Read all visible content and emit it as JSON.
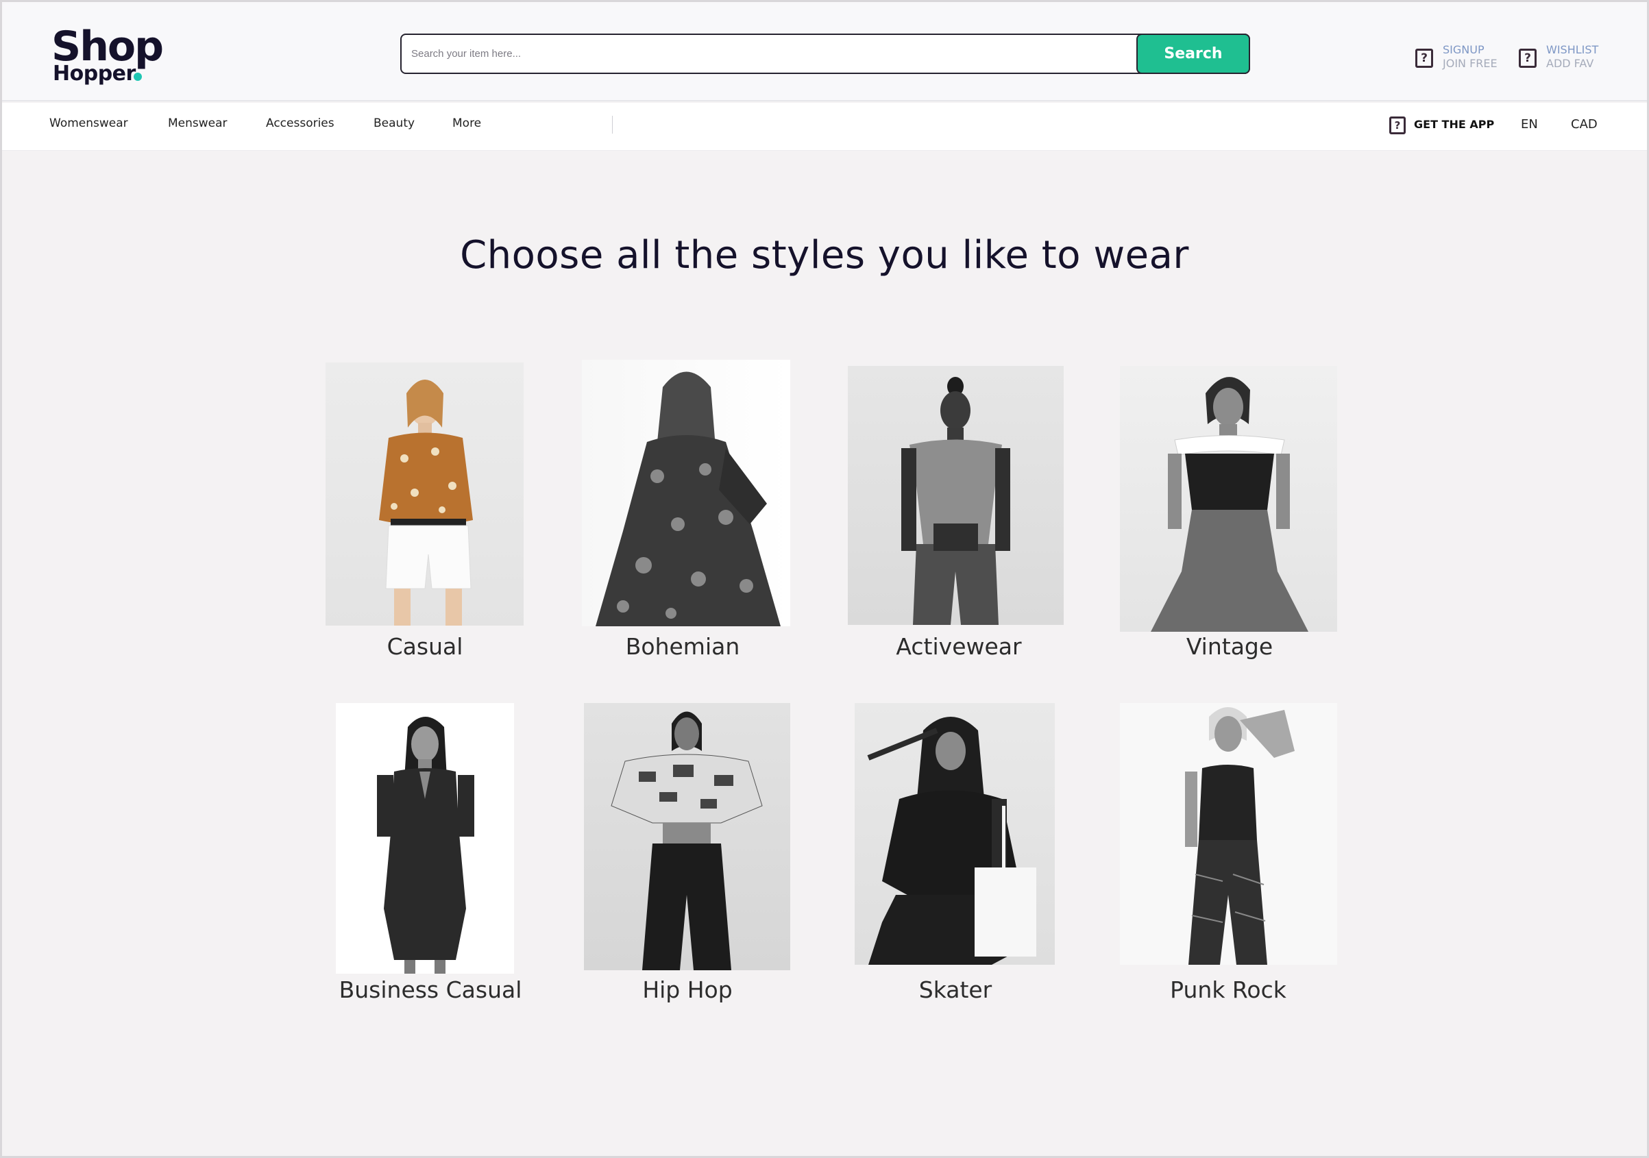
{
  "header": {
    "logo": {
      "word1": "Shop",
      "word2": "Hopper"
    },
    "search": {
      "placeholder": "Search your item here...",
      "button_label": "Search"
    },
    "signup": {
      "line1": "SIGNUP",
      "line2": "JOIN FREE",
      "icon": "question-box-icon"
    },
    "wishlist": {
      "line1": "WISHLIST",
      "line2": "ADD FAV",
      "icon": "question-box-icon"
    }
  },
  "nav": {
    "items": [
      "Womenswear",
      "Menswear",
      "Accessories",
      "Beauty",
      "More"
    ],
    "get_app": "GET THE APP",
    "language": "EN",
    "currency": "CAD"
  },
  "main": {
    "title": "Choose all the styles you like to wear",
    "styles": [
      {
        "label": "Casual"
      },
      {
        "label": "Bohemian"
      },
      {
        "label": "Activewear"
      },
      {
        "label": "Vintage"
      },
      {
        "label": "Business Casual"
      },
      {
        "label": "Hip Hop"
      },
      {
        "label": "Skater"
      },
      {
        "label": "Punk Rock"
      }
    ]
  },
  "colors": {
    "brand_dark": "#15122b",
    "accent_teal": "#1fc6b3",
    "search_button": "#1fbf91",
    "page_bg": "#f4f2f3"
  }
}
